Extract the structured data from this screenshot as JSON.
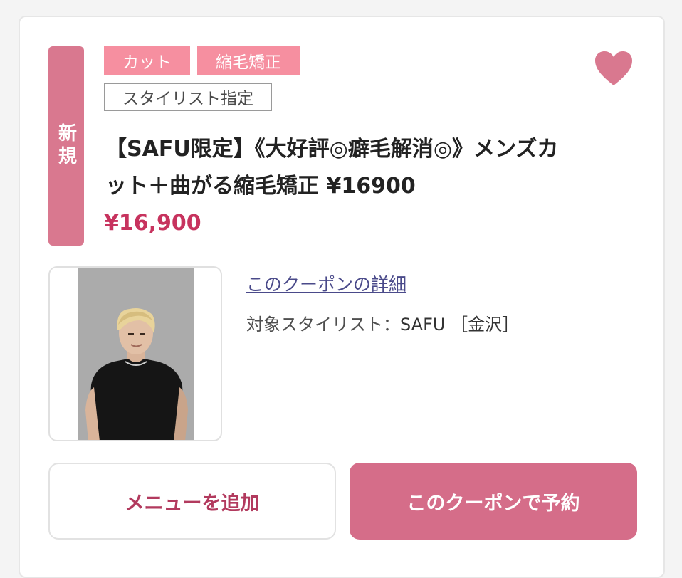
{
  "coupon": {
    "badge": "新規",
    "tags": [
      "カット",
      "縮毛矯正"
    ],
    "stylist_tag": "スタイリスト指定",
    "title": "【SAFU限定】《大好評◎癖毛解消◎》メンズカット＋曲がる縮毛矯正 ¥16900",
    "price": "¥16,900",
    "favorite_icon": "heart-icon",
    "detail_link": "このクーポンの詳細",
    "stylist_label": "対象スタイリスト：",
    "stylist_name": "SAFU ［金沢］"
  },
  "buttons": {
    "add_menu": "メニューを追加",
    "reserve": "このクーポンで予約"
  },
  "colors": {
    "accent": "#d56d89",
    "price": "#c7335e",
    "tag": "#f68fa0"
  }
}
